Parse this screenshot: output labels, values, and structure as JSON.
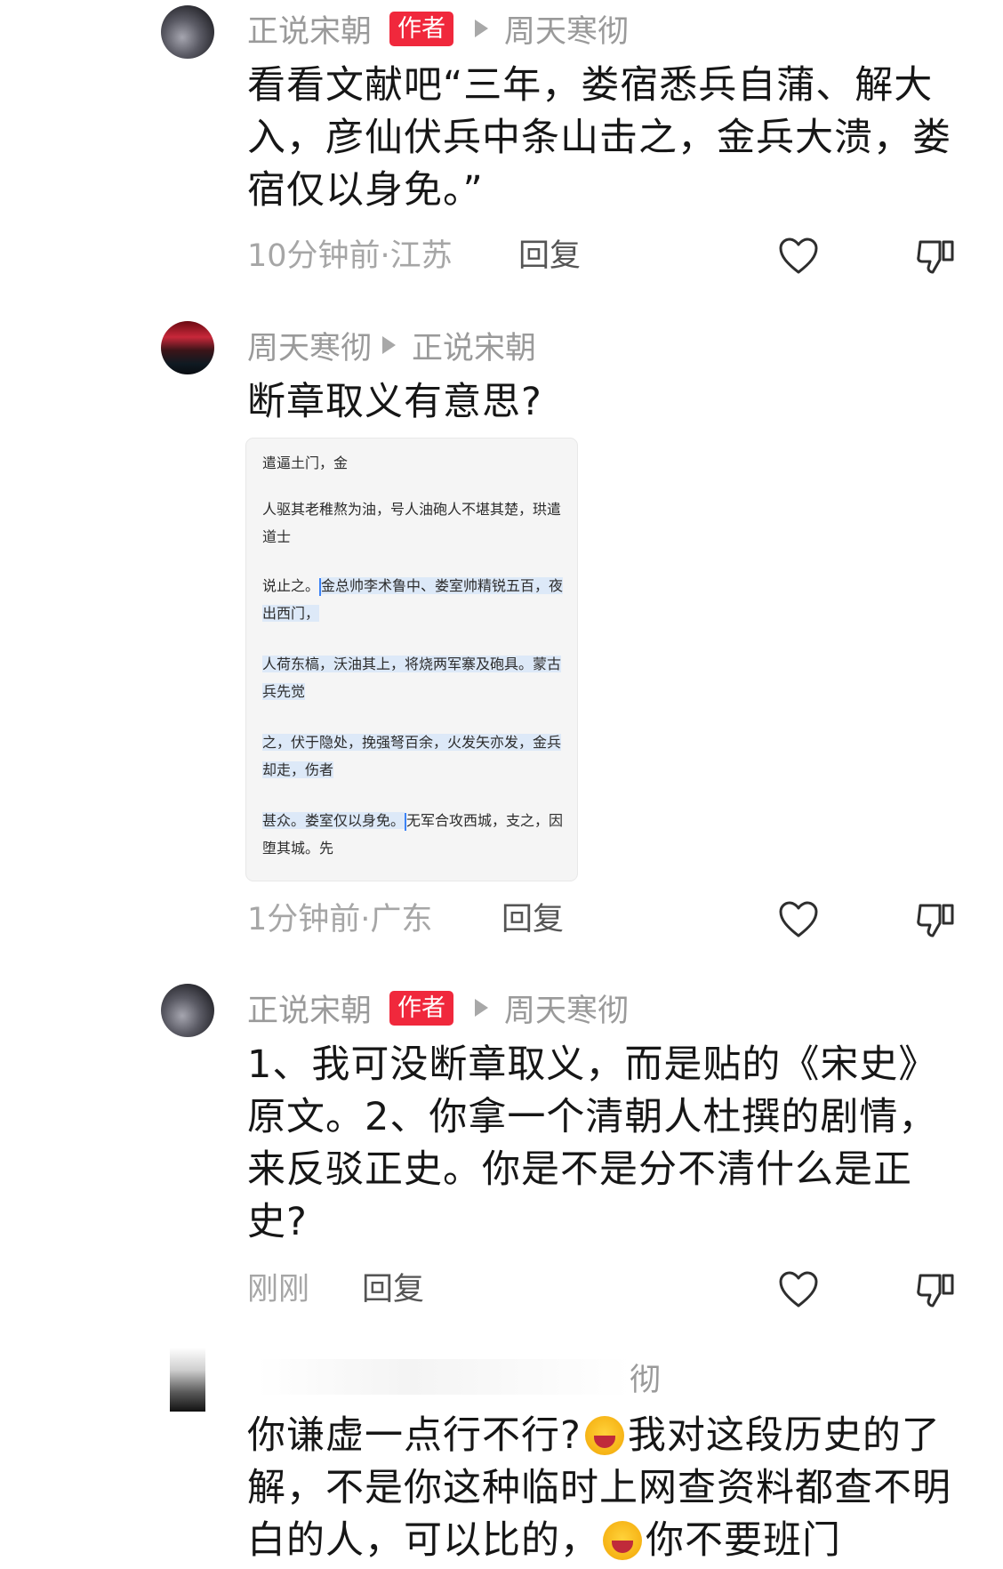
{
  "comments": [
    {
      "author": "正说宋朝",
      "badge": "作者",
      "reply_to": "周天寒彻",
      "text": "看看文献吧“三年，娄宿悉兵自蒲、解大入，彦仙伏兵中条山击之，金兵大溃，娄宿仅以身免。”",
      "time": "10分钟前·江苏",
      "reply_label": "回复"
    },
    {
      "author": "周天寒彻",
      "reply_to": "正说宋朝",
      "text": "断章取义有意思?",
      "time": "1分钟前·广东",
      "reply_label": "回复",
      "quote_image_text": {
        "p1": "遣逼土门，金",
        "p2": "人驱其老稚熬为油，号人油砲人不堪其楚，珙遣道士",
        "p3_plain": "说止之。",
        "p3_hl": "金总帅李术鲁中、娄室帅精锐五百，夜出西门，",
        "p4_hl": "人荷东槁，沃油其上，将烧两军寨及砲具。蒙古兵先觉",
        "p5_hl": "之，伏于隐处，挽强弩百余，火发矢亦发，金兵却走，伤者",
        "p6_hl": "甚众。娄室仅以身免。",
        "p6_plain": "无军合攻西城，支之，因堕其城。先"
      }
    },
    {
      "author": "正说宋朝",
      "badge": "作者",
      "reply_to": "周天寒彻",
      "text": "1、我可没断章取义，而是贴的《宋史》原文。2、你拿一个清朝人杜撰的剧情，来反驳正史。你是不是分不清什么是正史?",
      "time": "刚刚",
      "reply_label": "回复"
    },
    {
      "meta_partial": "彻",
      "text_a": "你谦虚一点行不行?",
      "text_b": "我对这段历史的了解，不是你这种临时上网查资料都查不明白的人，可以比的，",
      "text_c": "你不要班门"
    }
  ],
  "icons": {
    "like": "heart-outline-icon",
    "dislike": "thumbs-down-icon",
    "emoji": "laughing-crying-emoji-icon"
  },
  "colors": {
    "badge": "#f0283c",
    "meta_text": "#9a9a9a",
    "highlight": "#dde9f8"
  }
}
